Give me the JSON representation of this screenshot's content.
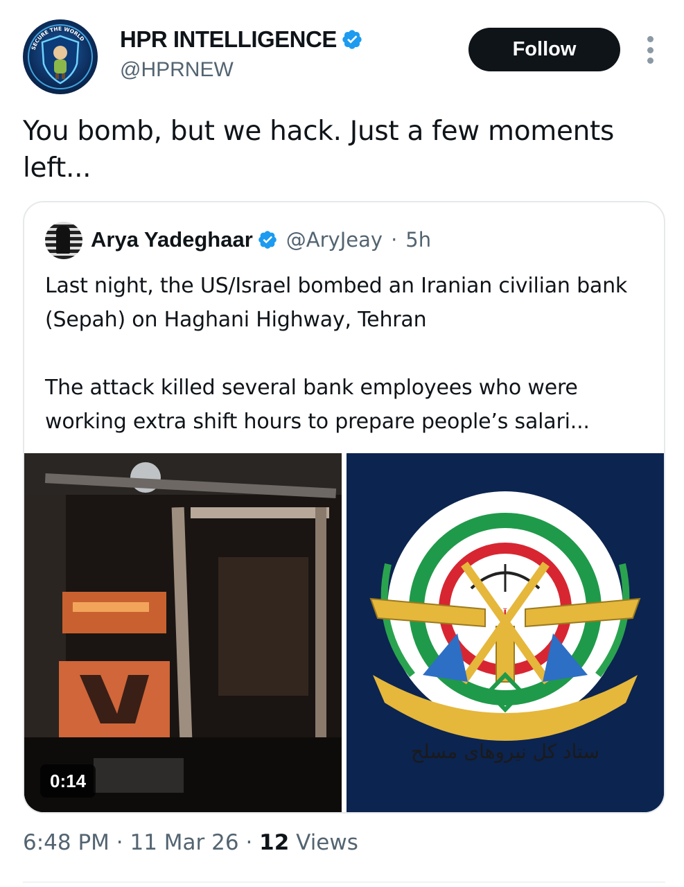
{
  "author": {
    "display_name": "HPR INTELLIGENCE",
    "handle": "@HPRNEW",
    "avatar_ring_text": "SECURE THE WORLD"
  },
  "actions": {
    "follow_label": "Follow"
  },
  "tweet": {
    "text": "You bomb, but we hack. Just a few moments left..."
  },
  "quoted_tweet": {
    "display_name": "Arya Yadeghaar",
    "handle": "@AryJeay",
    "separator": "·",
    "age": "5h",
    "text": "Last night, the US/Israel bombed an Iranian civilian bank (Sepah) on Haghani Highway, Tehran\n\nThe attack killed several bank employees who were working extra shift hours to prepare people’s salari...",
    "media": [
      {
        "kind": "video",
        "duration": "0:14"
      },
      {
        "kind": "image",
        "emblem_text": "ستاد کل نیروهای مسلح"
      }
    ]
  },
  "footer": {
    "time": "6:48 PM",
    "sep1": "·",
    "date": "11 Mar 26",
    "sep2": "·",
    "views_count": "12",
    "views_label": "Views"
  },
  "colors": {
    "verified": "#1d9bf0",
    "text_primary": "#0f1419",
    "text_secondary": "#536471",
    "border": "#e6e9eb"
  }
}
